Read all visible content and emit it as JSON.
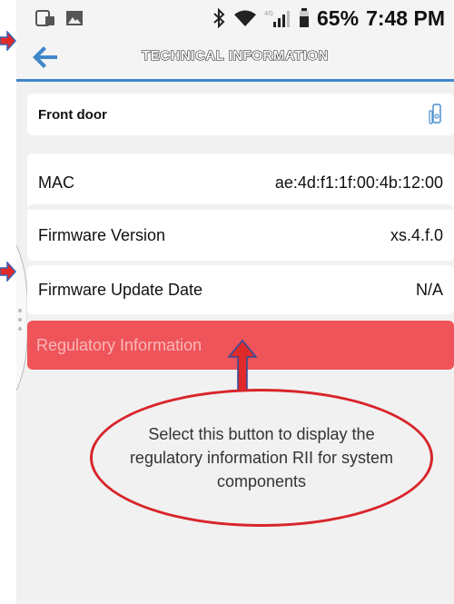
{
  "header": {
    "title": "TECHNICAL INFORMATION"
  },
  "status": {
    "battery": "65%",
    "time": "7:48 PM"
  },
  "device": {
    "name": "Front door"
  },
  "rows": [
    {
      "label": "MAC",
      "value": "ae:4d:f1:1f:00:4b:12:00"
    },
    {
      "label": "Firmware Version",
      "value": "xs.4.f.0"
    },
    {
      "label": "Firmware Update Date",
      "value": "N/A"
    }
  ],
  "regulatory_button": {
    "label": "Regulatory Information"
  },
  "annotation": {
    "text": "Select this button to display the regulatory information RII for system components"
  },
  "colors": {
    "accent": "#3f87c9",
    "button": "#ee5459",
    "callout": "#d8252b"
  },
  "icons": [
    "phone-icon",
    "image-icon",
    "bluetooth-icon",
    "wifi-icon",
    "signal-icon",
    "battery-icon",
    "back-arrow-icon",
    "door-sensor-icon"
  ]
}
